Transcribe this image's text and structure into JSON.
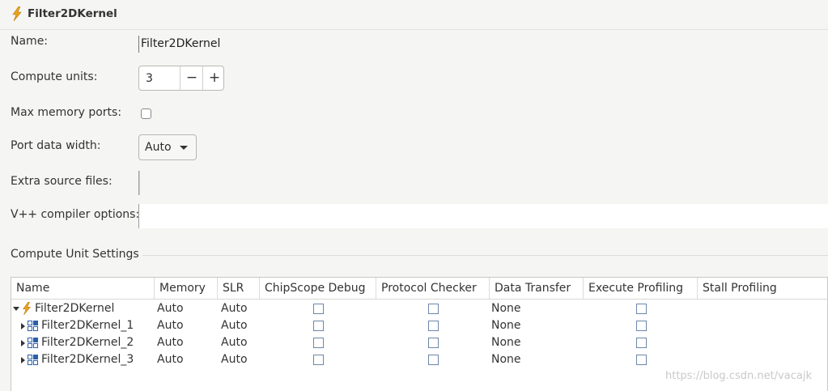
{
  "header": {
    "title": "Filter2DKernel"
  },
  "form": {
    "name_label": "Name:",
    "name_value": "Filter2DKernel",
    "compute_units_label": "Compute units:",
    "compute_units_value": "3",
    "minus": "−",
    "plus": "+",
    "max_memory_ports_label": "Max memory ports:",
    "port_data_width_label": "Port data width:",
    "port_data_width_value": "Auto",
    "extra_source_files_label": "Extra source files:",
    "compiler_options_label": "V++ compiler options:"
  },
  "section": {
    "title": "Compute Unit Settings"
  },
  "table": {
    "columns": [
      "Name",
      "Memory",
      "SLR",
      "ChipScope Debug",
      "Protocol Checker",
      "Data Transfer",
      "Execute Profiling",
      "Stall Profiling"
    ],
    "rows": [
      {
        "name": "Filter2DKernel",
        "memory": "Auto",
        "slr": "Auto",
        "data_transfer": "None",
        "expanded": true,
        "icon": "lightning-icon"
      },
      {
        "name": "Filter2DKernel_1",
        "memory": "Auto",
        "slr": "Auto",
        "data_transfer": "None",
        "expanded": false,
        "icon": "compute-unit-icon"
      },
      {
        "name": "Filter2DKernel_2",
        "memory": "Auto",
        "slr": "Auto",
        "data_transfer": "None",
        "expanded": false,
        "icon": "compute-unit-icon"
      },
      {
        "name": "Filter2DKernel_3",
        "memory": "Auto",
        "slr": "Auto",
        "data_transfer": "None",
        "expanded": false,
        "icon": "compute-unit-icon"
      }
    ]
  },
  "watermark": "https://blog.csdn.net/vacajk",
  "colors": {
    "accent_orange": "#e8a21c",
    "unit_blue": "#2d5fa8"
  }
}
